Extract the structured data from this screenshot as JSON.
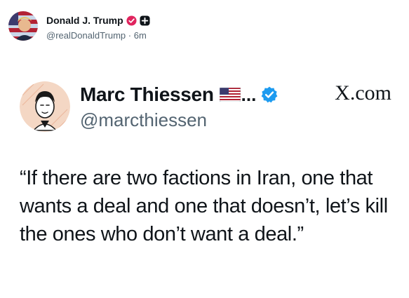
{
  "post": {
    "author_name": "Donald J. Trump",
    "handle": "@realDonaldTrump",
    "separator": " · ",
    "time_ago": "6m",
    "avatar_icon": "profile-avatar-icon",
    "badge_color": "#e0245e"
  },
  "card": {
    "author_name": "Marc Thiessen",
    "ellipsis": "...",
    "handle": "@marcthiessen",
    "site": "X.com",
    "verified_color": "#1d9bf0",
    "quote": "“If there are two factions in Iran, one that wants a deal and one that doesn’t, let’s kill the ones who don’t want a deal.”"
  }
}
